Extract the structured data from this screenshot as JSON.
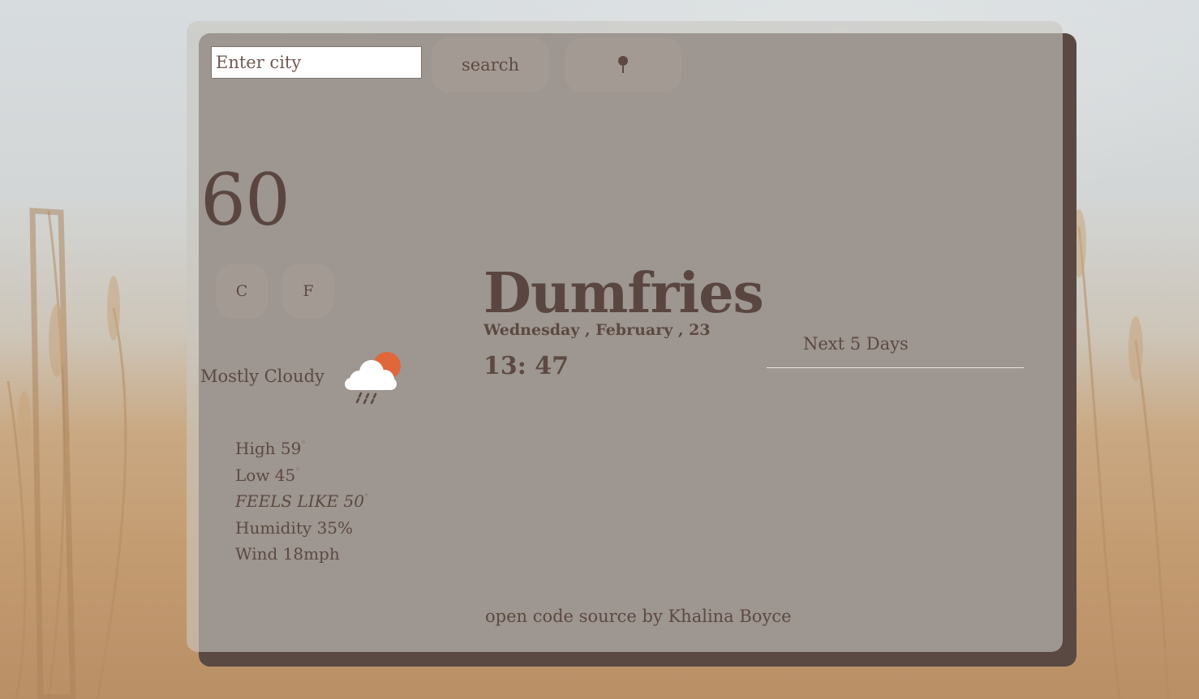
{
  "search": {
    "placeholder": "Enter city",
    "button_label": "search"
  },
  "location_button": {
    "icon": "map-pin-icon"
  },
  "current": {
    "temperature": "60",
    "unit_buttons": [
      "C",
      "F"
    ],
    "condition": "Mostly Cloudy",
    "condition_icon": "cloud-rain-sun-icon",
    "high_label": "High 59",
    "low_label": "Low 45",
    "feels_like_label": "FEELS LIKE 50",
    "degree_symbol": "°",
    "humidity_label": "Humidity 35%",
    "wind_label": "Wind 18mph"
  },
  "location": {
    "city": "Dumfries",
    "date": "Wednesday , February , 23",
    "time": "13: 47"
  },
  "forecast": {
    "title": "Next 5 Days"
  },
  "footer": {
    "credit": "open code source by Khalina Boyce"
  },
  "colors": {
    "text": "#5c4a42",
    "card_shadow": "#5a4943",
    "sun": "#e0673a",
    "button_bg": "#b8afa8"
  }
}
